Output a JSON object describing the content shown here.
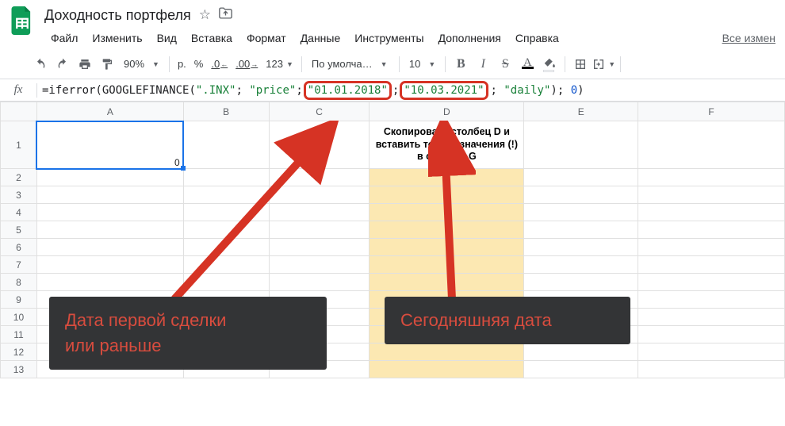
{
  "header": {
    "doc_title": "Доходность портфеля"
  },
  "menu": {
    "items": [
      "Файл",
      "Изменить",
      "Вид",
      "Вставка",
      "Формат",
      "Данные",
      "Инструменты",
      "Дополнения",
      "Справка"
    ],
    "tail": "Все измен"
  },
  "toolbar": {
    "zoom": "90%",
    "currency_btn": "р.",
    "percent_btn": "%",
    "dec_less": ".0",
    "dec_more": ".00",
    "num_fmt": "123",
    "font_name": "По умолча…",
    "font_size": "10",
    "bold": "B",
    "italic": "I",
    "strike": "S",
    "text_color_letter": "A"
  },
  "formula_bar": {
    "fx_label": "fx",
    "parts": {
      "p1": "=iferror(",
      "p2": "GOOGLEFINANCE",
      "p3": "(",
      "s1": "\".INX\"",
      "sep": "; ",
      "s2": "\"price\"",
      "d1": "\"01.01.2018\"",
      "d2": "\"10.03.2021\"",
      "s3": "\"daily\"",
      "p4": "); ",
      "n1": "0",
      "p5": ")"
    }
  },
  "grid": {
    "columns": [
      "A",
      "B",
      "C",
      "D",
      "E",
      "F"
    ],
    "row_numbers": [
      "1",
      "2",
      "3",
      "4",
      "5",
      "6",
      "7",
      "8",
      "9",
      "10",
      "11",
      "12",
      "13"
    ],
    "cells": {
      "A1": "0",
      "D1": "Скопировать столбец D и вставить только значения (!) в столбец G"
    }
  },
  "annotations": {
    "a1_line1": "Дата первой сделки",
    "a1_line2": "или раньше",
    "a2": "Сегодняшняя дата"
  }
}
